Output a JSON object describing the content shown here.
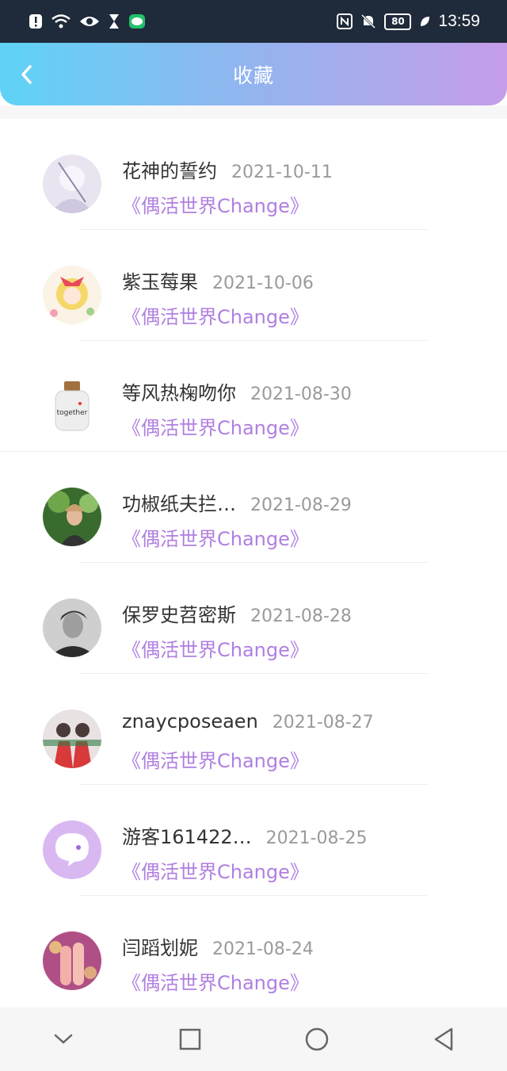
{
  "status_bar": {
    "time": "13:59",
    "battery": "80",
    "icons": [
      "alert-icon",
      "wifi-icon",
      "eye-icon",
      "hourglass-icon",
      "chat-icon",
      "nfc-icon",
      "mute-bell-icon",
      "battery-icon",
      "leaf-icon"
    ]
  },
  "header": {
    "title": "收藏",
    "back_icon": "chevron-left-icon"
  },
  "items": [
    {
      "name": "花神的誓约",
      "date": "2021-10-11",
      "work": "《偶活世界Change》"
    },
    {
      "name": "紫玉莓果",
      "date": "2021-10-06",
      "work": "《偶活世界Change》"
    },
    {
      "name": "等风热椈吻你",
      "date": "2021-08-30",
      "work": "《偶活世界Change》"
    },
    {
      "name": "功椒纸夫拦…",
      "date": "2021-08-29",
      "work": "《偶活世界Change》"
    },
    {
      "name": "保罗史苕密斯",
      "date": "2021-08-28",
      "work": "《偶活世界Change》"
    },
    {
      "name": "znaycposeaen",
      "date": "2021-08-27",
      "work": "《偶活世界Change》"
    },
    {
      "name": "游客161422…",
      "date": "2021-08-25",
      "work": "《偶活世界Change》"
    },
    {
      "name": "闫蹈划妮",
      "date": "2021-08-24",
      "work": "《偶活世界Change》"
    }
  ],
  "nav": [
    "chevron-down-icon",
    "square-icon",
    "circle-icon",
    "triangle-back-icon"
  ],
  "colors": {
    "accent": "#b07fe0",
    "header_start": "#5fd3f6",
    "header_end": "#c59de8"
  }
}
